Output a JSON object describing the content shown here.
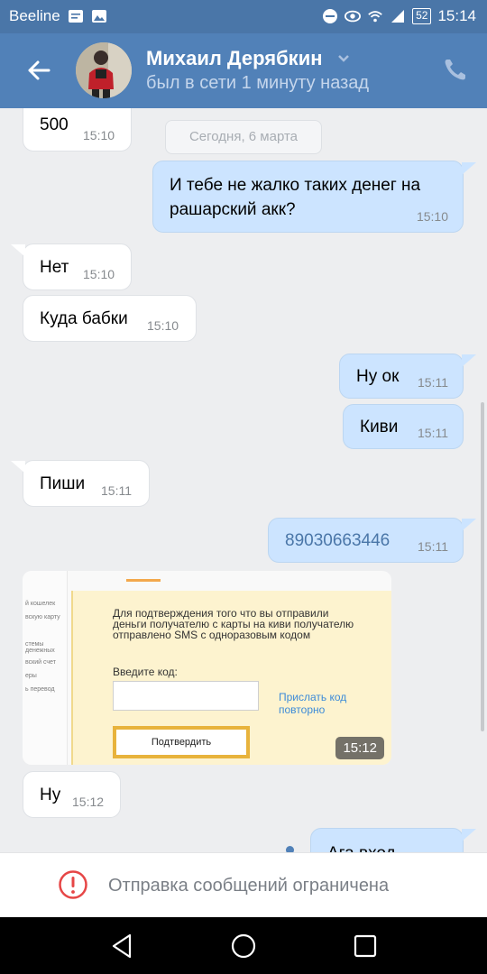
{
  "status_bar": {
    "carrier": "Beeline",
    "battery": "52",
    "time": "15:14"
  },
  "header": {
    "contact_name": "Михаил Дерябкин",
    "last_seen": "был в сети 1 минуту назад"
  },
  "chat": {
    "date_separator": "Сегодня, 6 марта",
    "messages": [
      {
        "direction": "in",
        "text": "500",
        "time": "15:10"
      },
      {
        "direction": "out",
        "text": "И тебе не жалко таких денег на\nрашарский акк?",
        "time": "15:10"
      },
      {
        "direction": "in",
        "text": "Нет",
        "time": "15:10"
      },
      {
        "direction": "in",
        "text": "Куда бабки",
        "time": "15:10"
      },
      {
        "direction": "out",
        "text": "Ну ок",
        "time": "15:11"
      },
      {
        "direction": "out",
        "text": "Киви",
        "time": "15:11"
      },
      {
        "direction": "in",
        "text": "Пиши",
        "time": "15:11"
      },
      {
        "direction": "out",
        "text": "89030663446",
        "time": "15:11"
      },
      {
        "direction": "in",
        "text": "Ну",
        "time": "15:12"
      },
      {
        "direction": "out",
        "text": "Ага вход",
        "time": ""
      }
    ],
    "image_message": {
      "time": "15:12",
      "sidebar_items": [
        "й кошелек",
        "вскую карту",
        "стемы денежных",
        "вский счет",
        "еры",
        "ь перевод"
      ],
      "info_text": "Для подтверждения того что вы отправили деньги получателю с карты на киви получателю отправлено SMS с одноразовым кодом",
      "code_label": "Введите код:",
      "resend_link": "Прислать код повторно",
      "confirm_button": "Подтвердить"
    }
  },
  "composer": {
    "restricted_text": "Отправка сообщений ограничена"
  },
  "colors": {
    "header": "#5181b8",
    "status_bar": "#4a76a8",
    "outgoing_bubble": "#cce4ff",
    "incoming_bubble": "#ffffff",
    "warning": "#e64646"
  }
}
